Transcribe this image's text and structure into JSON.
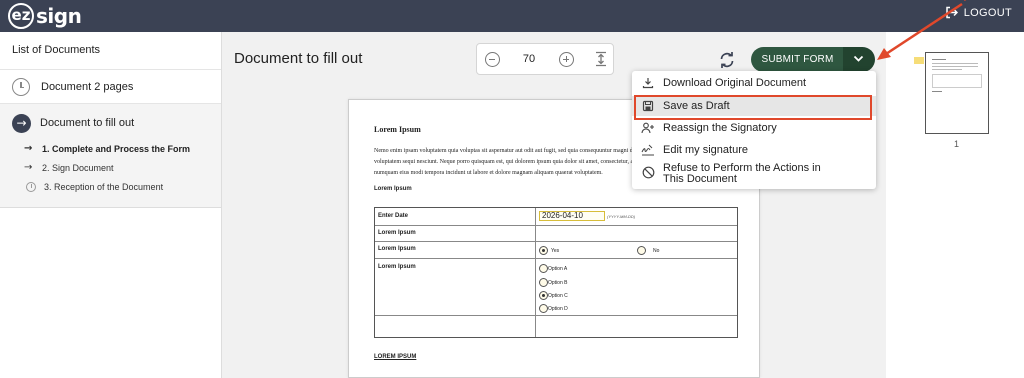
{
  "header": {
    "logo_mark": "ez",
    "logo_text": "sign",
    "logout_label": "LOGOUT"
  },
  "sidebar": {
    "title": "List of Documents",
    "documents": [
      {
        "label": "Document 2 pages",
        "icon": "clock-icon"
      },
      {
        "label": "Document to fill out",
        "icon": "arrow-right-circle-icon",
        "active": true
      }
    ],
    "steps": [
      {
        "label": "1. Complete and Process the Form",
        "icon": "arrow-right-icon",
        "current": true
      },
      {
        "label": "2. Sign Document",
        "icon": "arrow-right-icon"
      },
      {
        "label": "3. Reception of the Document",
        "icon": "clock-icon"
      }
    ]
  },
  "main": {
    "title": "Document to fill out",
    "zoom_value": "70",
    "submit_label": "SUBMIT FORM"
  },
  "menu": {
    "items": [
      {
        "label": "Download Original Document",
        "icon": "download-icon"
      },
      {
        "label": "Save as Draft",
        "icon": "save-icon",
        "highlighted": true
      },
      {
        "label": "Reassign the Signatory",
        "icon": "person-add-icon"
      },
      {
        "label": "Edit my signature",
        "icon": "signature-icon"
      },
      {
        "label": "Refuse to Perform the Actions in This Document",
        "icon": "block-icon"
      }
    ]
  },
  "document": {
    "heading": "Lorem Ipsum",
    "paragraph_lines": [
      "Nemo enim ipsam voluptatem quia voluptas sit aspernatur aut odit aut fugit, sed quia consequuntur magni dolores eos qui ratione",
      "voluptatem sequi nesciunt. Neque porro quisquam est, qui dolorem ipsum quia dolor sit amet, consectetur, adipisci velit, sed quia non",
      "numquam eius modi tempora incidunt ut labore et dolore magnam aliquam quaerat voluptatem."
    ],
    "subheading": "Lorem Ipsum",
    "table": {
      "date_label": "Enter Date",
      "date_value": "2026-04-10",
      "date_hint": "(YYYY-MM-DD)",
      "row2_label": "Lorem Ipsum",
      "row3_label": "Lorem Ipsum",
      "yes_label": "Yes",
      "no_label": "No",
      "row4_label": "Lorem Ipsum",
      "options": [
        "Option A",
        "Option B",
        "Option C",
        "Option D"
      ],
      "selected_option": "Option C"
    },
    "footer_heading": "LOREM IPSUM"
  },
  "thumbnails": {
    "page_number": "1"
  },
  "colors": {
    "header_bg": "#3b4254",
    "submit_bg": "#2f5740",
    "annotation": "#e0482b",
    "date_field_border": "#d7bd3a"
  }
}
